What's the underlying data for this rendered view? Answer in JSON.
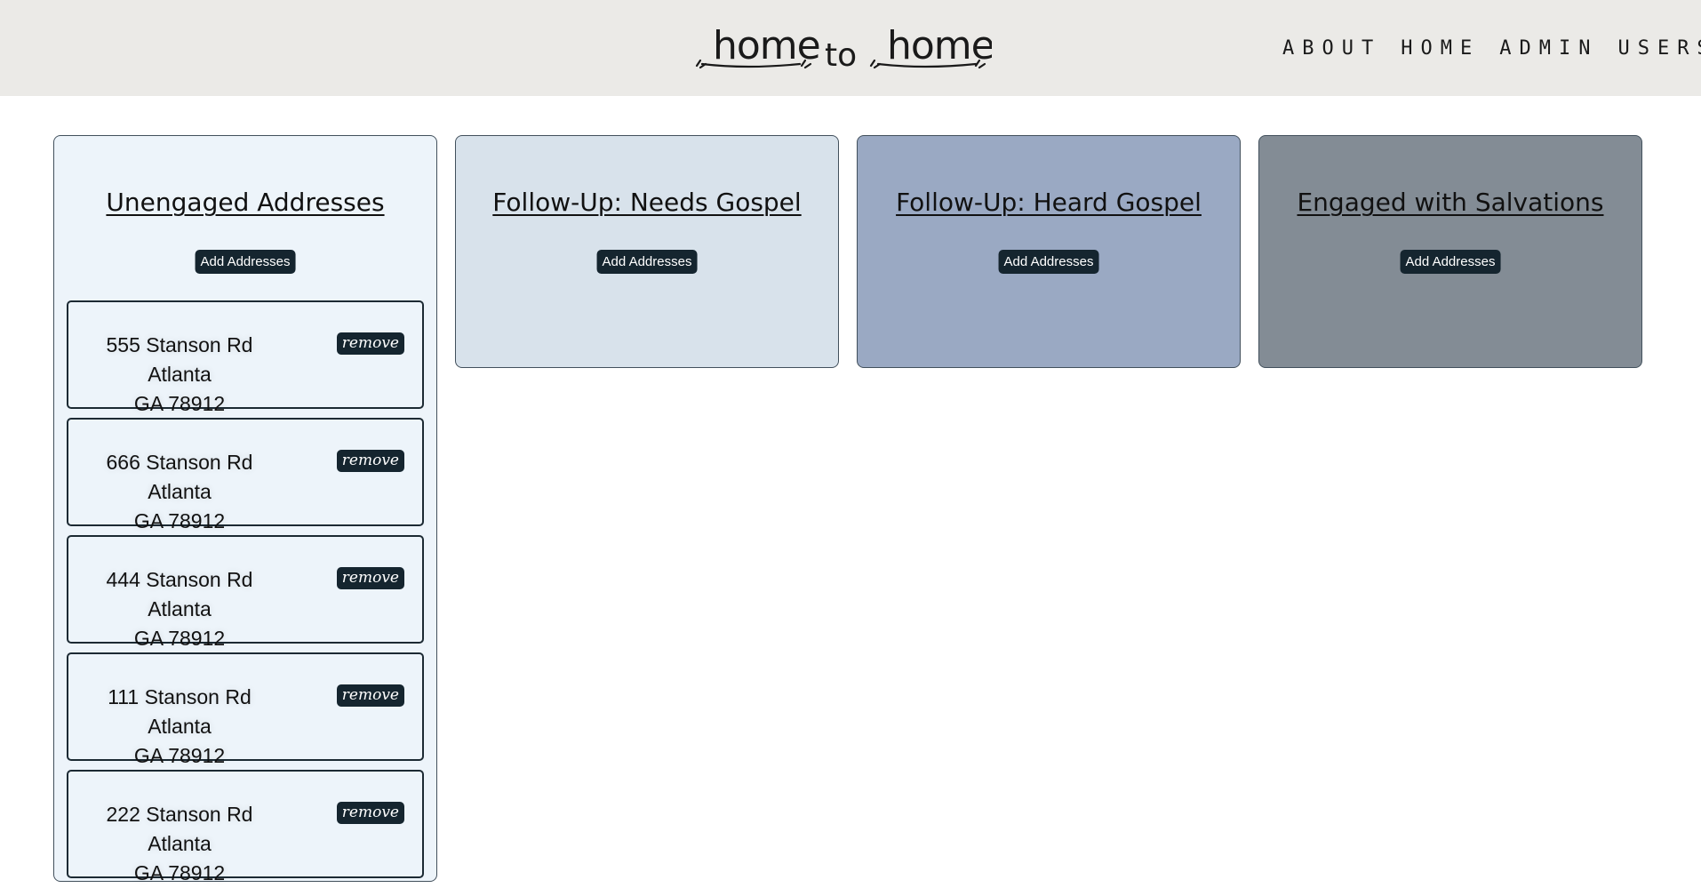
{
  "header": {
    "logo": {
      "word1": "home",
      "word2": "to",
      "word3": "home"
    },
    "nav": [
      "ABOUT",
      "HOME",
      "ADMIN",
      "USERS"
    ]
  },
  "columns": [
    {
      "title": "Unengaged Addresses",
      "add_label": "Add Addresses",
      "color": "#edf4fa"
    },
    {
      "title": "Follow-Up: Needs Gospel",
      "add_label": "Add Addresses",
      "color": "#d8e2eb"
    },
    {
      "title": "Follow-Up: Heard Gospel",
      "add_label": "Add Addresses",
      "color": "#9aa9c3"
    },
    {
      "title": "Engaged with Salvations",
      "add_label": "Add Addresses",
      "color": "#838c95"
    }
  ],
  "addresses": [
    {
      "line1": "555 Stanson Rd Atlanta",
      "line2": "GA 78912",
      "remove_label": "remove"
    },
    {
      "line1": "666 Stanson Rd Atlanta",
      "line2": "GA 78912",
      "remove_label": "remove"
    },
    {
      "line1": "444 Stanson Rd Atlanta",
      "line2": "GA 78912",
      "remove_label": "remove"
    },
    {
      "line1": "111 Stanson Rd Atlanta",
      "line2": "GA 78912",
      "remove_label": "remove"
    },
    {
      "line1": "222 Stanson Rd Atlanta",
      "line2": "GA 78912",
      "remove_label": "remove"
    }
  ],
  "colors": {
    "header_bg": "#ebeae7",
    "button_bg": "#15252f"
  }
}
